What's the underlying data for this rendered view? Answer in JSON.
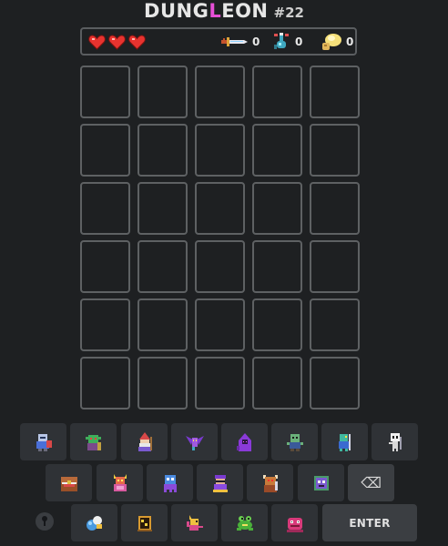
{
  "title": {
    "word_before": "DUNG",
    "word_accent": "L",
    "word_after": "EON",
    "number": "#22"
  },
  "status": {
    "hearts": 3,
    "sword_count": "0",
    "potion_count": "0",
    "food_count": "0"
  },
  "board": {
    "rows": 6,
    "cols": 5
  },
  "keyboard": {
    "row1": [
      "knight-icon",
      "goblin-icon",
      "wizard-icon",
      "bat-icon",
      "hooded-mage-icon",
      "zombie-icon",
      "lizard-warrior-icon",
      "skeleton-icon"
    ],
    "row2": [
      "chest-mimic-icon",
      "demon-icon",
      "ghost-icon",
      "rogue-icon",
      "minotaur-icon",
      "golem-icon"
    ],
    "row3": [
      "orb-icon",
      "treasure-icon",
      "imp-icon",
      "frog-icon",
      "slime-beast-icon"
    ],
    "backspace_label": "⌫",
    "enter_label": "ENTER"
  },
  "colors": {
    "background": "#1e2022",
    "cell_border": "#5e6163",
    "key_bg": "#2f3236",
    "accent": "#e64fd6",
    "heart": "#e8332f"
  }
}
